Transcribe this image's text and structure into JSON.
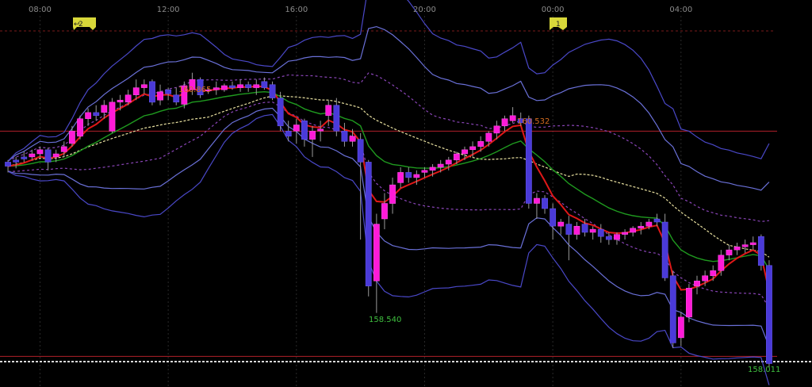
{
  "chart_data": {
    "type": "candlestick",
    "x_ticks": [
      "08:00",
      "12:00",
      "16:00",
      "20:00",
      "00:00",
      "04:00"
    ],
    "annotations": {
      "high_label": "160.865",
      "high2_label": "160.532",
      "low_label": "158.540",
      "low2_label": "158.011"
    },
    "badges": [
      "2",
      "1"
    ],
    "ylim": [
      157.9,
      161.4
    ],
    "levels": [
      160.3,
      158.12
    ],
    "candles": [
      [
        160.0,
        160.02,
        159.9,
        159.96
      ],
      [
        160.02,
        160.05,
        159.94,
        160.0
      ],
      [
        160.05,
        160.1,
        160.0,
        160.03
      ],
      [
        160.05,
        160.12,
        160.02,
        160.08
      ],
      [
        160.08,
        160.15,
        160.05,
        160.12
      ],
      [
        160.12,
        160.14,
        159.92,
        160.0
      ],
      [
        160.05,
        160.12,
        160.0,
        160.08
      ],
      [
        160.1,
        160.2,
        160.05,
        160.15
      ],
      [
        160.18,
        160.35,
        160.15,
        160.3
      ],
      [
        160.25,
        160.45,
        160.22,
        160.42
      ],
      [
        160.42,
        160.52,
        160.35,
        160.48
      ],
      [
        160.48,
        160.55,
        160.4,
        160.45
      ],
      [
        160.48,
        160.6,
        160.42,
        160.55
      ],
      [
        160.3,
        160.62,
        160.28,
        160.58
      ],
      [
        160.58,
        160.65,
        160.5,
        160.6
      ],
      [
        160.58,
        160.7,
        160.55,
        160.65
      ],
      [
        160.65,
        160.8,
        160.6,
        160.72
      ],
      [
        160.72,
        160.8,
        160.66,
        160.75
      ],
      [
        160.78,
        160.8,
        160.55,
        160.58
      ],
      [
        160.6,
        160.75,
        160.55,
        160.68
      ],
      [
        160.7,
        160.72,
        160.6,
        160.66
      ],
      [
        160.65,
        160.72,
        160.55,
        160.58
      ],
      [
        160.56,
        160.78,
        160.52,
        160.74
      ],
      [
        160.7,
        160.865,
        160.65,
        160.8
      ],
      [
        160.8,
        160.82,
        160.62,
        160.65
      ],
      [
        160.7,
        160.72,
        160.66,
        160.7
      ],
      [
        160.7,
        160.78,
        160.65,
        160.72
      ],
      [
        160.7,
        160.76,
        160.68,
        160.74
      ],
      [
        160.74,
        160.78,
        160.7,
        160.72
      ],
      [
        160.72,
        160.8,
        160.68,
        160.75
      ],
      [
        160.75,
        160.78,
        160.68,
        160.72
      ],
      [
        160.72,
        160.8,
        160.65,
        160.75
      ],
      [
        160.78,
        160.82,
        160.7,
        160.72
      ],
      [
        160.75,
        160.78,
        160.6,
        160.62
      ],
      [
        160.62,
        160.68,
        160.3,
        160.35
      ],
      [
        160.3,
        160.4,
        160.2,
        160.25
      ],
      [
        160.3,
        160.42,
        160.18,
        160.36
      ],
      [
        160.4,
        160.42,
        160.15,
        160.22
      ],
      [
        160.22,
        160.35,
        160.05,
        160.3
      ],
      [
        160.3,
        160.4,
        160.2,
        160.32
      ],
      [
        160.45,
        160.6,
        160.35,
        160.55
      ],
      [
        160.55,
        160.62,
        160.25,
        160.3
      ],
      [
        160.3,
        160.38,
        160.15,
        160.2
      ],
      [
        160.2,
        160.32,
        160.15,
        160.25
      ],
      [
        160.22,
        160.28,
        159.25,
        160.0
      ],
      [
        160.0,
        160.02,
        158.7,
        158.8
      ],
      [
        158.85,
        159.5,
        158.54,
        159.4
      ],
      [
        159.45,
        159.7,
        159.35,
        159.6
      ],
      [
        159.6,
        159.85,
        159.5,
        159.78
      ],
      [
        159.8,
        159.95,
        159.75,
        159.9
      ],
      [
        159.9,
        159.95,
        159.8,
        159.85
      ],
      [
        159.85,
        159.92,
        159.78,
        159.88
      ],
      [
        159.9,
        159.95,
        159.85,
        159.92
      ],
      [
        159.92,
        159.98,
        159.86,
        159.95
      ],
      [
        159.95,
        160.02,
        159.9,
        159.98
      ],
      [
        159.98,
        160.05,
        159.92,
        160.02
      ],
      [
        160.02,
        160.1,
        159.98,
        160.08
      ],
      [
        160.08,
        160.15,
        160.02,
        160.12
      ],
      [
        160.12,
        160.2,
        160.05,
        160.15
      ],
      [
        160.15,
        160.25,
        160.1,
        160.2
      ],
      [
        160.2,
        160.3,
        160.15,
        160.28
      ],
      [
        160.28,
        160.4,
        160.22,
        160.35
      ],
      [
        160.35,
        160.45,
        160.3,
        160.42
      ],
      [
        160.4,
        160.532,
        160.38,
        160.45
      ],
      [
        160.42,
        160.48,
        160.35,
        160.38
      ],
      [
        160.42,
        160.45,
        159.55,
        159.6
      ],
      [
        159.6,
        159.7,
        159.45,
        159.65
      ],
      [
        159.65,
        159.68,
        159.5,
        159.55
      ],
      [
        159.55,
        159.6,
        159.25,
        159.38
      ],
      [
        159.38,
        159.45,
        159.3,
        159.42
      ],
      [
        159.4,
        159.48,
        159.05,
        159.3
      ],
      [
        159.3,
        159.42,
        159.25,
        159.38
      ],
      [
        159.4,
        159.45,
        159.28,
        159.32
      ],
      [
        159.32,
        159.38,
        159.25,
        159.35
      ],
      [
        159.35,
        159.4,
        159.22,
        159.28
      ],
      [
        159.28,
        159.32,
        159.2,
        159.25
      ],
      [
        159.25,
        159.32,
        159.2,
        159.3
      ],
      [
        159.3,
        159.35,
        159.25,
        159.32
      ],
      [
        159.32,
        159.38,
        159.28,
        159.36
      ],
      [
        159.36,
        159.42,
        159.3,
        159.38
      ],
      [
        159.38,
        159.45,
        159.35,
        159.42
      ],
      [
        159.45,
        159.5,
        159.38,
        159.42
      ],
      [
        159.42,
        159.5,
        158.85,
        158.88
      ],
      [
        158.9,
        158.95,
        158.2,
        158.25
      ],
      [
        158.3,
        158.55,
        158.22,
        158.5
      ],
      [
        158.5,
        158.82,
        158.45,
        158.78
      ],
      [
        158.8,
        158.9,
        158.72,
        158.85
      ],
      [
        158.85,
        158.95,
        158.8,
        158.9
      ],
      [
        158.9,
        159.0,
        158.85,
        158.95
      ],
      [
        158.95,
        159.15,
        158.9,
        159.1
      ],
      [
        159.1,
        159.2,
        159.05,
        159.15
      ],
      [
        159.15,
        159.22,
        159.1,
        159.18
      ],
      [
        159.18,
        159.25,
        159.12,
        159.2
      ],
      [
        159.2,
        159.28,
        159.15,
        159.22
      ],
      [
        159.28,
        159.3,
        158.95,
        159.0
      ],
      [
        159.0,
        159.05,
        158.011,
        158.05
      ]
    ]
  }
}
